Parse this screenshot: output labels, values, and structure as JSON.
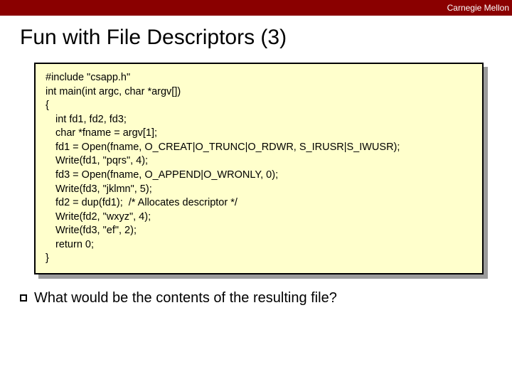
{
  "header": {
    "institution": "Carnegie Mellon"
  },
  "title": "Fun with File Descriptors (3)",
  "code": {
    "lines": [
      {
        "text": "#include \"csapp.h\"",
        "indent": false
      },
      {
        "text": "int main(int argc, char *argv[])",
        "indent": false
      },
      {
        "text": "{",
        "indent": false
      },
      {
        "text": "int fd1, fd2, fd3;",
        "indent": true
      },
      {
        "text": "char *fname = argv[1];",
        "indent": true
      },
      {
        "text": "fd1 = Open(fname, O_CREAT|O_TRUNC|O_RDWR, S_IRUSR|S_IWUSR);",
        "indent": true
      },
      {
        "text": "Write(fd1, \"pqrs\", 4);",
        "indent": true
      },
      {
        "text": "fd3 = Open(fname, O_APPEND|O_WRONLY, 0);",
        "indent": true
      },
      {
        "text": "Write(fd3, \"jklmn\", 5);",
        "indent": true
      },
      {
        "text": "fd2 = dup(fd1);  /* Allocates descriptor */",
        "indent": true
      },
      {
        "text": "Write(fd2, \"wxyz\", 4);",
        "indent": true
      },
      {
        "text": "Write(fd3, \"ef\", 2);",
        "indent": true
      },
      {
        "text": "return 0;",
        "indent": true
      },
      {
        "text": "}",
        "indent": false
      }
    ]
  },
  "question": "What would be the contents of the resulting file?"
}
